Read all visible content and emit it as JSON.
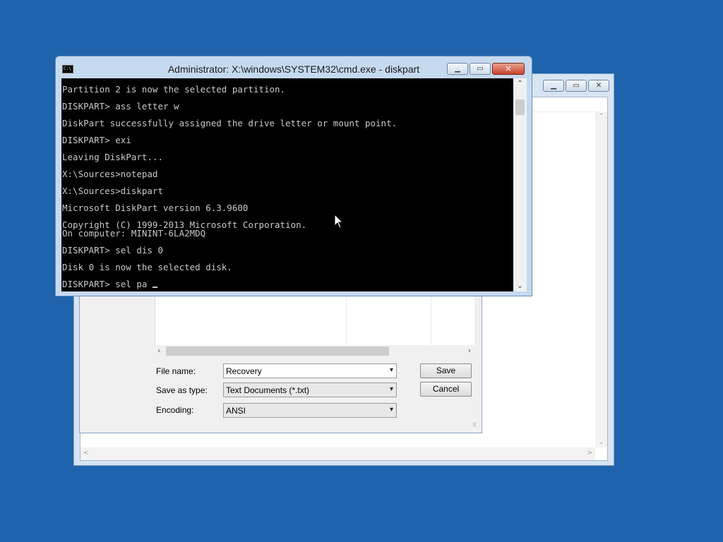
{
  "notepad": {
    "minimize_icon": "minimize-icon",
    "maximize_icon": "maximize-icon",
    "close_icon": "close-icon"
  },
  "save_dialog": {
    "file_name_label": "File name:",
    "file_name_value": "Recovery",
    "save_as_type_label": "Save as type:",
    "save_as_type_value": "Text Documents (*.txt)",
    "encoding_label": "Encoding:",
    "encoding_value": "ANSI",
    "save_button": "Save",
    "cancel_button": "Cancel"
  },
  "cmd": {
    "title": "Administrator: X:\\windows\\SYSTEM32\\cmd.exe - diskpart",
    "icon_text": "C:\\",
    "lines": [
      "Partition 2 is now the selected partition.",
      "",
      "DISKPART> ass letter w",
      "",
      "DiskPart successfully assigned the drive letter or mount point.",
      "",
      "DISKPART> exi",
      "",
      "Leaving DiskPart...",
      "",
      "X:\\Sources>notepad",
      "",
      "X:\\Sources>diskpart",
      "",
      "Microsoft DiskPart version 6.3.9600",
      "",
      "Copyright (C) 1999-2013 Microsoft Corporation.",
      "On computer: MININT-6LA2MDQ",
      "",
      "DISKPART> sel dis 0",
      "",
      "Disk 0 is now the selected disk.",
      "",
      "DISKPART> sel pa "
    ]
  }
}
